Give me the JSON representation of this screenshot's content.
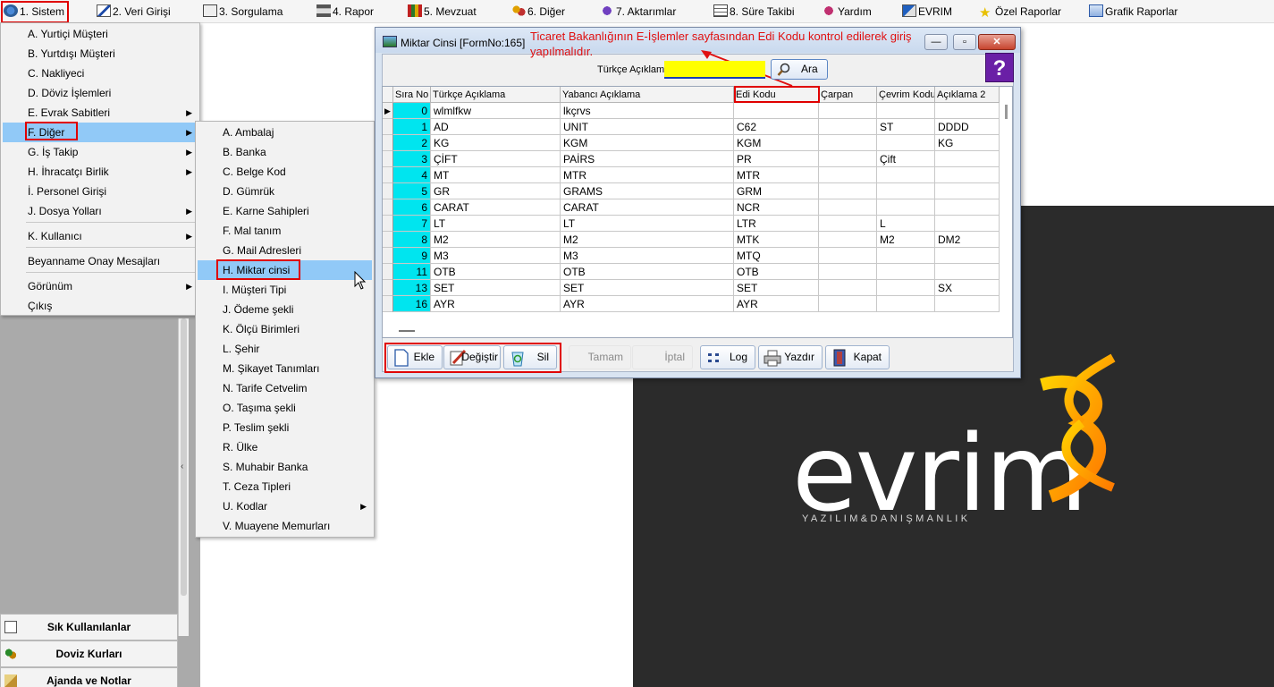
{
  "menubar": {
    "items": [
      {
        "label": "1.  Sistem",
        "icon": "system-icon"
      },
      {
        "label": "2.  Veri Girişi",
        "icon": "edit-icon"
      },
      {
        "label": "3.  Sorgulama",
        "icon": "query-icon"
      },
      {
        "label": "4.  Rapor",
        "icon": "printer-icon"
      },
      {
        "label": "5.  Mevzuat",
        "icon": "books-icon"
      },
      {
        "label": "6.  Diğer",
        "icon": "people-icon"
      },
      {
        "label": "7.  Aktarımlar",
        "icon": "transfer-icon"
      },
      {
        "label": "8. Süre Takibi",
        "icon": "clipboard-icon"
      },
      {
        "label": "Yardım",
        "icon": "help-icon"
      },
      {
        "label": "EVRIM",
        "icon": "evrim-icon"
      },
      {
        "label": "Özel Raporlar",
        "icon": "star-icon"
      },
      {
        "label": "Grafik Raporlar",
        "icon": "chart-icon"
      }
    ]
  },
  "sistem_menu": {
    "items": [
      {
        "label": "A.  Yurtiçi Müşteri",
        "submenu": false
      },
      {
        "label": "B.  Yurtdışı Müşteri",
        "submenu": false
      },
      {
        "label": "C.  Nakliyeci",
        "submenu": false
      },
      {
        "label": "D.  Döviz İşlemleri",
        "submenu": false
      },
      {
        "label": "E.  Evrak Sabitleri",
        "submenu": true
      },
      {
        "label": "F.  Diğer",
        "submenu": true
      },
      {
        "label": "G.  İş Takip",
        "submenu": true
      },
      {
        "label": "H.  İhracatçı Birlik",
        "submenu": true
      },
      {
        "label": "İ.   Personel Girişi",
        "submenu": false
      },
      {
        "label": "J.  Dosya Yolları",
        "submenu": true
      },
      {
        "label": "K.  Kullanıcı",
        "submenu": true
      },
      {
        "label": "Beyanname Onay Mesajları",
        "submenu": false
      },
      {
        "label": "Görünüm",
        "submenu": true
      },
      {
        "label": "Çıkış",
        "submenu": false
      }
    ]
  },
  "diger_submenu": {
    "items": [
      {
        "label": "A.  Ambalaj",
        "submenu": false
      },
      {
        "label": "B.  Banka",
        "submenu": false
      },
      {
        "label": "C.  Belge Kod",
        "submenu": false
      },
      {
        "label": "D.  Gümrük",
        "submenu": false
      },
      {
        "label": "E.  Karne Sahipleri",
        "submenu": false
      },
      {
        "label": "F.  Mal tanım",
        "submenu": false
      },
      {
        "label": "G.  Mail Adresleri",
        "submenu": false
      },
      {
        "label": "H.  Miktar cinsi",
        "submenu": false
      },
      {
        "label": "I.  Müşteri Tipi",
        "submenu": false
      },
      {
        "label": "J.  Ödeme şekli",
        "submenu": false
      },
      {
        "label": "K.  Ölçü Birimleri",
        "submenu": false
      },
      {
        "label": "L.  Şehir",
        "submenu": false
      },
      {
        "label": "M.  Şikayet Tanımları",
        "submenu": false
      },
      {
        "label": "N.  Tarife Cetvelim",
        "submenu": false
      },
      {
        "label": "O.  Taşıma şekli",
        "submenu": false
      },
      {
        "label": "P.  Teslim şekli",
        "submenu": false
      },
      {
        "label": "R.  Ülke",
        "submenu": false
      },
      {
        "label": "S.  Muhabir Banka",
        "submenu": false
      },
      {
        "label": "T.  Ceza Tipleri",
        "submenu": false
      },
      {
        "label": "U. Kodlar",
        "submenu": true
      },
      {
        "label": "V. Muayene Memurları",
        "submenu": false
      }
    ]
  },
  "left_panel": {
    "buttons": [
      {
        "label": "Sık Kullanılanlar",
        "icon": "favorites-icon"
      },
      {
        "label": "Doviz Kurları",
        "icon": "currency-icon"
      },
      {
        "label": "Ajanda ve Notlar",
        "icon": "notes-icon"
      }
    ]
  },
  "window": {
    "title": "Miktar Cinsi [FormNo:165]",
    "annotation": "Ticaret Bakanlığının E-İşlemler sayfasından Edi Kodu kontrol edilerek giriş yapılmalıdır.",
    "search": {
      "label": "Türkçe Açıklama Ara",
      "value": "",
      "button": "Ara"
    },
    "help": "?",
    "columns": [
      "Sıra No",
      "Türkçe Açıklama",
      "Yabancı Açıklama",
      "Edi Kodu",
      "Çarpan",
      "Çevrim Kodu",
      "Açıklama 2"
    ],
    "rows": [
      [
        "0",
        "wlmlfkw",
        "lkçrvs",
        "",
        "",
        "",
        ""
      ],
      [
        "1",
        "AD",
        "UNIT",
        "C62",
        "",
        "ST",
        "DDDD"
      ],
      [
        "2",
        "KG",
        "KGM",
        "KGM",
        "",
        "",
        "KG"
      ],
      [
        "3",
        "ÇİFT",
        "PAİRS",
        "PR",
        "",
        "Çift",
        ""
      ],
      [
        "4",
        "MT",
        "MTR",
        "MTR",
        "",
        "",
        ""
      ],
      [
        "5",
        "GR",
        "GRAMS",
        "GRM",
        "",
        "",
        ""
      ],
      [
        "6",
        "CARAT",
        "CARAT",
        "NCR",
        "",
        "",
        ""
      ],
      [
        "7",
        "LT",
        "LT",
        "LTR",
        "",
        "L",
        ""
      ],
      [
        "8",
        "M2",
        "M2",
        "MTK",
        "",
        "M2",
        "DM2"
      ],
      [
        "9",
        "M3",
        "M3",
        "MTQ",
        "",
        "",
        ""
      ],
      [
        "11",
        "OTB",
        "OTB",
        "OTB",
        "",
        "",
        ""
      ],
      [
        "13",
        "SET",
        "SET",
        "SET",
        "",
        "",
        "SX"
      ],
      [
        "16",
        "AYR",
        "AYR",
        "AYR",
        "",
        "",
        ""
      ]
    ],
    "toolbar": {
      "ekle": "Ekle",
      "degistir": "Değiştir",
      "sil": "Sil",
      "tamam": "Tamam",
      "iptal": "İptal",
      "log": "Log",
      "yazdir": "Yazdır",
      "kapat": "Kapat"
    }
  },
  "logo": {
    "text": "evrim",
    "subtitle": "YAZILIM&DANIŞMANLIK"
  },
  "colors": {
    "highlight": "#e00000",
    "selected": "#91c9f7",
    "sira_cell": "#00e5ef",
    "search_bg": "#ffff00",
    "annotation": "#e01010",
    "logo_bg": "#2b2b2b"
  }
}
